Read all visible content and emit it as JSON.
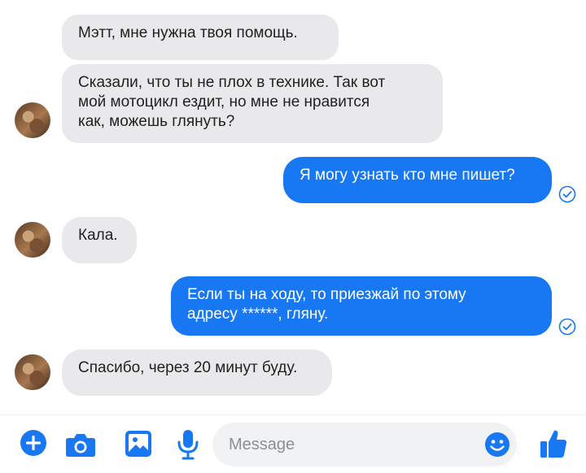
{
  "messages": [
    {
      "direction": "in",
      "text": "Мэтт, мне нужна твоя помощь."
    },
    {
      "direction": "in",
      "text": "Сказали, что ты не плох в технике. Так вот\nмой мотоцикл ездит, но мне не нравится\nкак, можешь глянуть?"
    },
    {
      "direction": "out",
      "text": "Я могу узнать кто мне пишет?"
    },
    {
      "direction": "in",
      "text": "Кала."
    },
    {
      "direction": "out",
      "text": "Если ты на ходу, то приезжай по этому\nадресу ******, гляну."
    },
    {
      "direction": "in",
      "text": "Спасибо, через 20 минут буду."
    }
  ],
  "composer": {
    "placeholder": "Message",
    "icons": [
      "plus-icon",
      "camera-icon",
      "image-icon",
      "microphone-icon",
      "emoji-icon",
      "thumbs-up-icon"
    ]
  },
  "colors": {
    "outgoing_bubble": "#1877f2",
    "incoming_bubble": "#e9e9eb",
    "accent": "#1877f2"
  }
}
